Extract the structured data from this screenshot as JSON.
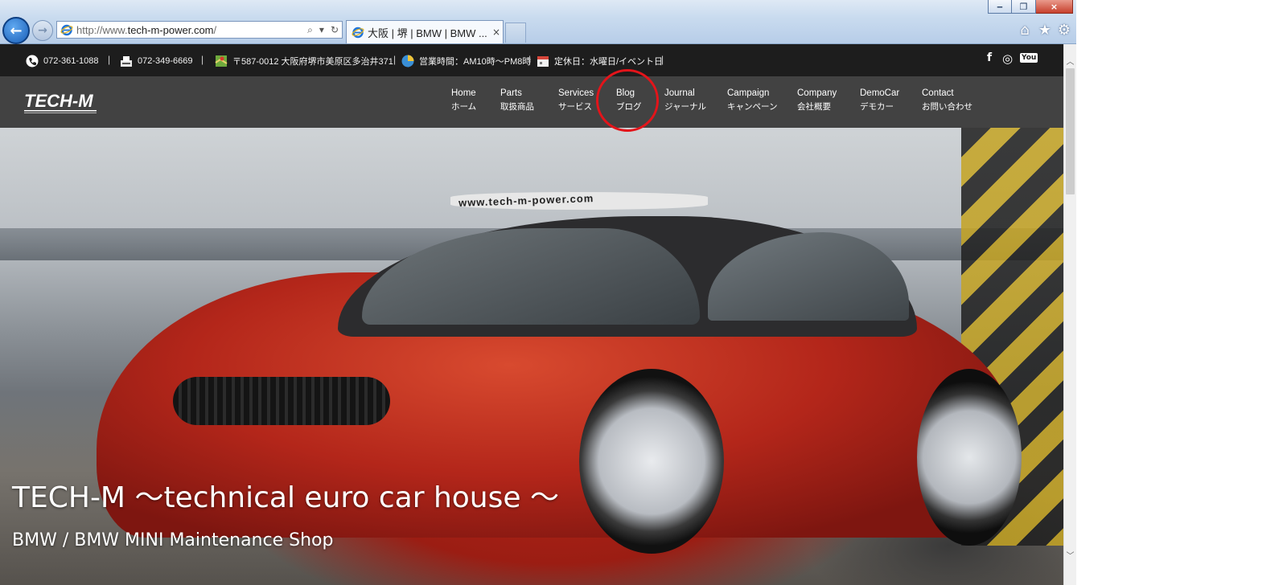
{
  "browser": {
    "address_url": "http://www.",
    "address_domain": "tech-m-power.com",
    "address_tail": "/",
    "tab_title": "大阪 | 堺 | BMW | BMW ...",
    "tab_close": "×",
    "window_minimize": "‒",
    "window_maximize": "❐",
    "window_close": "×",
    "back_glyph": "←",
    "forward_glyph": "→",
    "search_glyph": "⌕",
    "dropdown_glyph": "▾",
    "refresh_glyph": "↻",
    "home_glyph": "⌂",
    "favorites_glyph": "★",
    "tools_glyph": "⚙"
  },
  "infobar": {
    "phone": "072-361-1088",
    "fax": "072-349-6669",
    "address": "〒587-0012 大阪府堺市美原区多治井371",
    "hours": "営業時間：AM10時〜PM8時",
    "closed": "定休日：水曜日/イベント日",
    "separator": "|",
    "social": {
      "facebook": "f",
      "instagram": "◎",
      "youtube": "You"
    }
  },
  "logo_text": "TECH-M",
  "nav": [
    {
      "en": "Home",
      "jp": "ホーム"
    },
    {
      "en": "Parts",
      "jp": "取扱商品"
    },
    {
      "en": "Services",
      "jp": "サービス"
    },
    {
      "en": "Blog",
      "jp": "ブログ"
    },
    {
      "en": "Journal",
      "jp": "ジャーナル"
    },
    {
      "en": "Campaign",
      "jp": "キャンペーン"
    },
    {
      "en": "Company",
      "jp": "会社概要"
    },
    {
      "en": "DemoCar",
      "jp": "デモカー"
    },
    {
      "en": "Contact",
      "jp": "お問い合わせ"
    }
  ],
  "hero": {
    "title": "TECH-M 〜technical euro car house 〜",
    "subtitle": "BMW / BMW MINI Maintenance Shop",
    "windshield_banner": "www.tech-m-power.com"
  },
  "scrollbar": {
    "up": "︿",
    "down": "﹀"
  },
  "colors": {
    "highlight_circle": "#e3141a",
    "infobar_bg": "#1d1d1d",
    "navbar_bg": "#282828"
  }
}
